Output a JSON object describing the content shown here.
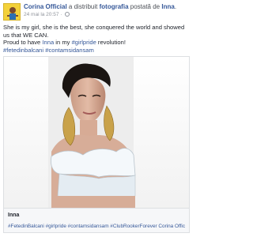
{
  "post": {
    "author": "Corina Official",
    "action_text": "a distribuit",
    "shared_item": "fotografia",
    "possessive_text": "postată de",
    "original_author": "Inna",
    "period": ".",
    "timestamp": "24 mai la 20:57 · ",
    "body_line1": "She is my girl, she is the best, she conquered the world and showed us that WE CAN.",
    "body_line2_prefix": "Proud to have ",
    "body_line2_mention": "Inna",
    "body_line2_mid": " in my ",
    "body_line2_tag": "#girlpride",
    "body_line2_suffix": " revolution!",
    "hashtag1": "#fetedinbalcani",
    "hashtag2": "#contamsidansam"
  },
  "attachment": {
    "title": "Inna",
    "caption": "#FetedinBalcani #girlpride #contamsidansam #ClubRookerForever Corina Official"
  },
  "colors": {
    "link": "#365899",
    "meta": "#90949c",
    "avatar_bg": "#f3d13a"
  }
}
